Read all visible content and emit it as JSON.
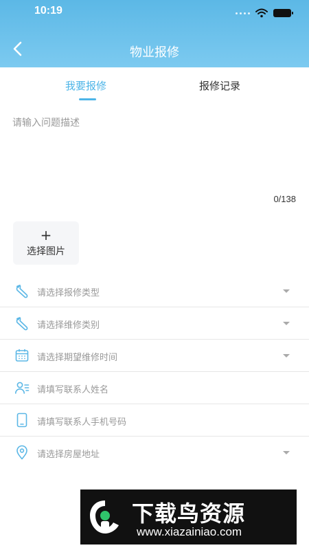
{
  "status_bar": {
    "time": "10:19"
  },
  "nav": {
    "title": "物业报修",
    "back_icon": "chevron-left-icon"
  },
  "tabs": [
    {
      "label": "我要报修",
      "active": true
    },
    {
      "label": "报修记录",
      "active": false
    }
  ],
  "description": {
    "placeholder": "请输入问题描述",
    "value": "",
    "counter": "0/138"
  },
  "image_picker": {
    "plus": "+",
    "label": "选择图片"
  },
  "form_rows": [
    {
      "label": "请选择报修类型",
      "icon": "wrench-icon",
      "has_dropdown": true
    },
    {
      "label": "请选择维修类别",
      "icon": "wrench-icon",
      "has_dropdown": true
    },
    {
      "label": "请选择期望维修时间",
      "icon": "calendar-icon",
      "has_dropdown": true
    },
    {
      "label": "请填写联系人姓名",
      "icon": "contact-person-icon",
      "has_dropdown": false
    },
    {
      "label": "请填写联系人手机号码",
      "icon": "phone-icon",
      "has_dropdown": false
    },
    {
      "label": "请选择房屋地址",
      "icon": "location-pin-icon",
      "has_dropdown": true
    }
  ],
  "watermark": {
    "title": "下载鸟资源",
    "url": "www.xiazainiao.com"
  },
  "colors": {
    "accent": "#4db5e8",
    "header_top": "#5cb8e6",
    "header_bottom": "#7ccaf0",
    "placeholder": "#999999"
  }
}
